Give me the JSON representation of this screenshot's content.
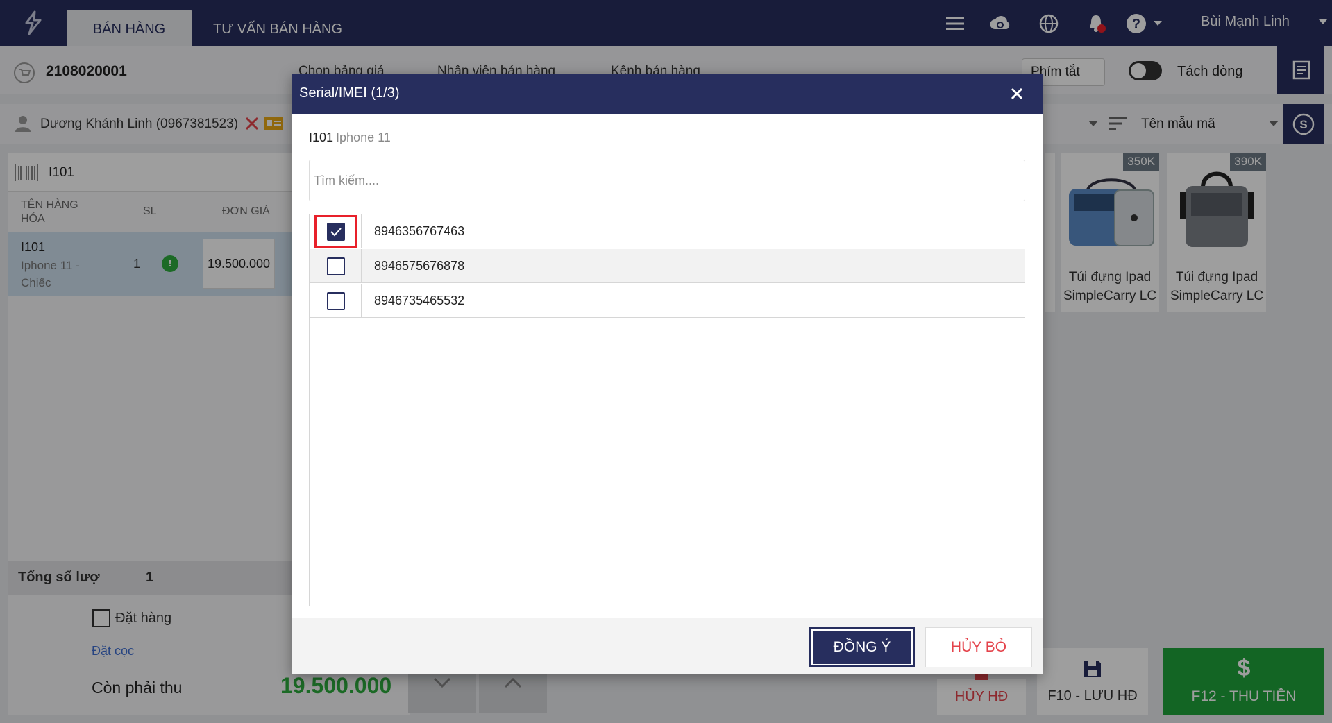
{
  "colors": {
    "primary": "#272e5e",
    "success": "#1fa33a",
    "danger": "#e4434b",
    "highlight": "#e8202a"
  },
  "topbar": {
    "tabs": [
      {
        "label": "BÁN HÀNG"
      },
      {
        "label": "TƯ VẤN BÁN HÀNG"
      }
    ],
    "user_name": "Bùi Mạnh Linh",
    "icons": [
      "menu-icon",
      "cloud-sync-icon",
      "globe-icon",
      "bell-icon",
      "help-icon"
    ]
  },
  "invoice": {
    "id": "2108020001",
    "toolbar": {
      "price_list": "Chọn bảng giá",
      "staff": "Nhân viên bán hàng",
      "channel": "Kênh bán hàng",
      "shortcuts": "Phím tắt",
      "split_line": "Tách dòng"
    }
  },
  "customer": {
    "name": "Dương Khánh Linh (0967381523)"
  },
  "filter": {
    "sort_label": "Tên mẫu mã"
  },
  "cart": {
    "barcode_value": "I101",
    "headers": {
      "name": "TÊN HÀNG HÓA",
      "qty": "SL",
      "price": "ĐƠN GIÁ"
    },
    "line": {
      "code": "I101",
      "name": "Iphone 11 - Chiếc",
      "qty": "1",
      "price": "19.500.000"
    },
    "total_label": "Tổng số lượ",
    "total_qty": "1",
    "order_label": "Đặt hàng",
    "deposit_label": "Đặt cọc",
    "due_label": "Còn phải thu",
    "due_amount": "19.500.000"
  },
  "products": [
    {
      "price": "350K",
      "name": "Túi đựng Ipad SimpleCarry LC"
    },
    {
      "price": "390K",
      "name": "Túi đựng Ipad SimpleCarry LC"
    }
  ],
  "actions": {
    "cancel_invoice": "HỦY HĐ",
    "save_invoice": "F10 - LƯU HĐ",
    "pay": "F12 - THU TIỀN"
  },
  "modal": {
    "title": "Serial/IMEI (1/3)",
    "product_code": "I101",
    "product_name": "Iphone 11",
    "search_placeholder": "Tìm kiếm....",
    "serials": [
      {
        "value": "8946356767463",
        "checked": true
      },
      {
        "value": "8946575676878",
        "checked": false
      },
      {
        "value": "8946735465532",
        "checked": false
      }
    ],
    "ok_label": "ĐỒNG Ý",
    "cancel_label": "HỦY BỎ"
  }
}
